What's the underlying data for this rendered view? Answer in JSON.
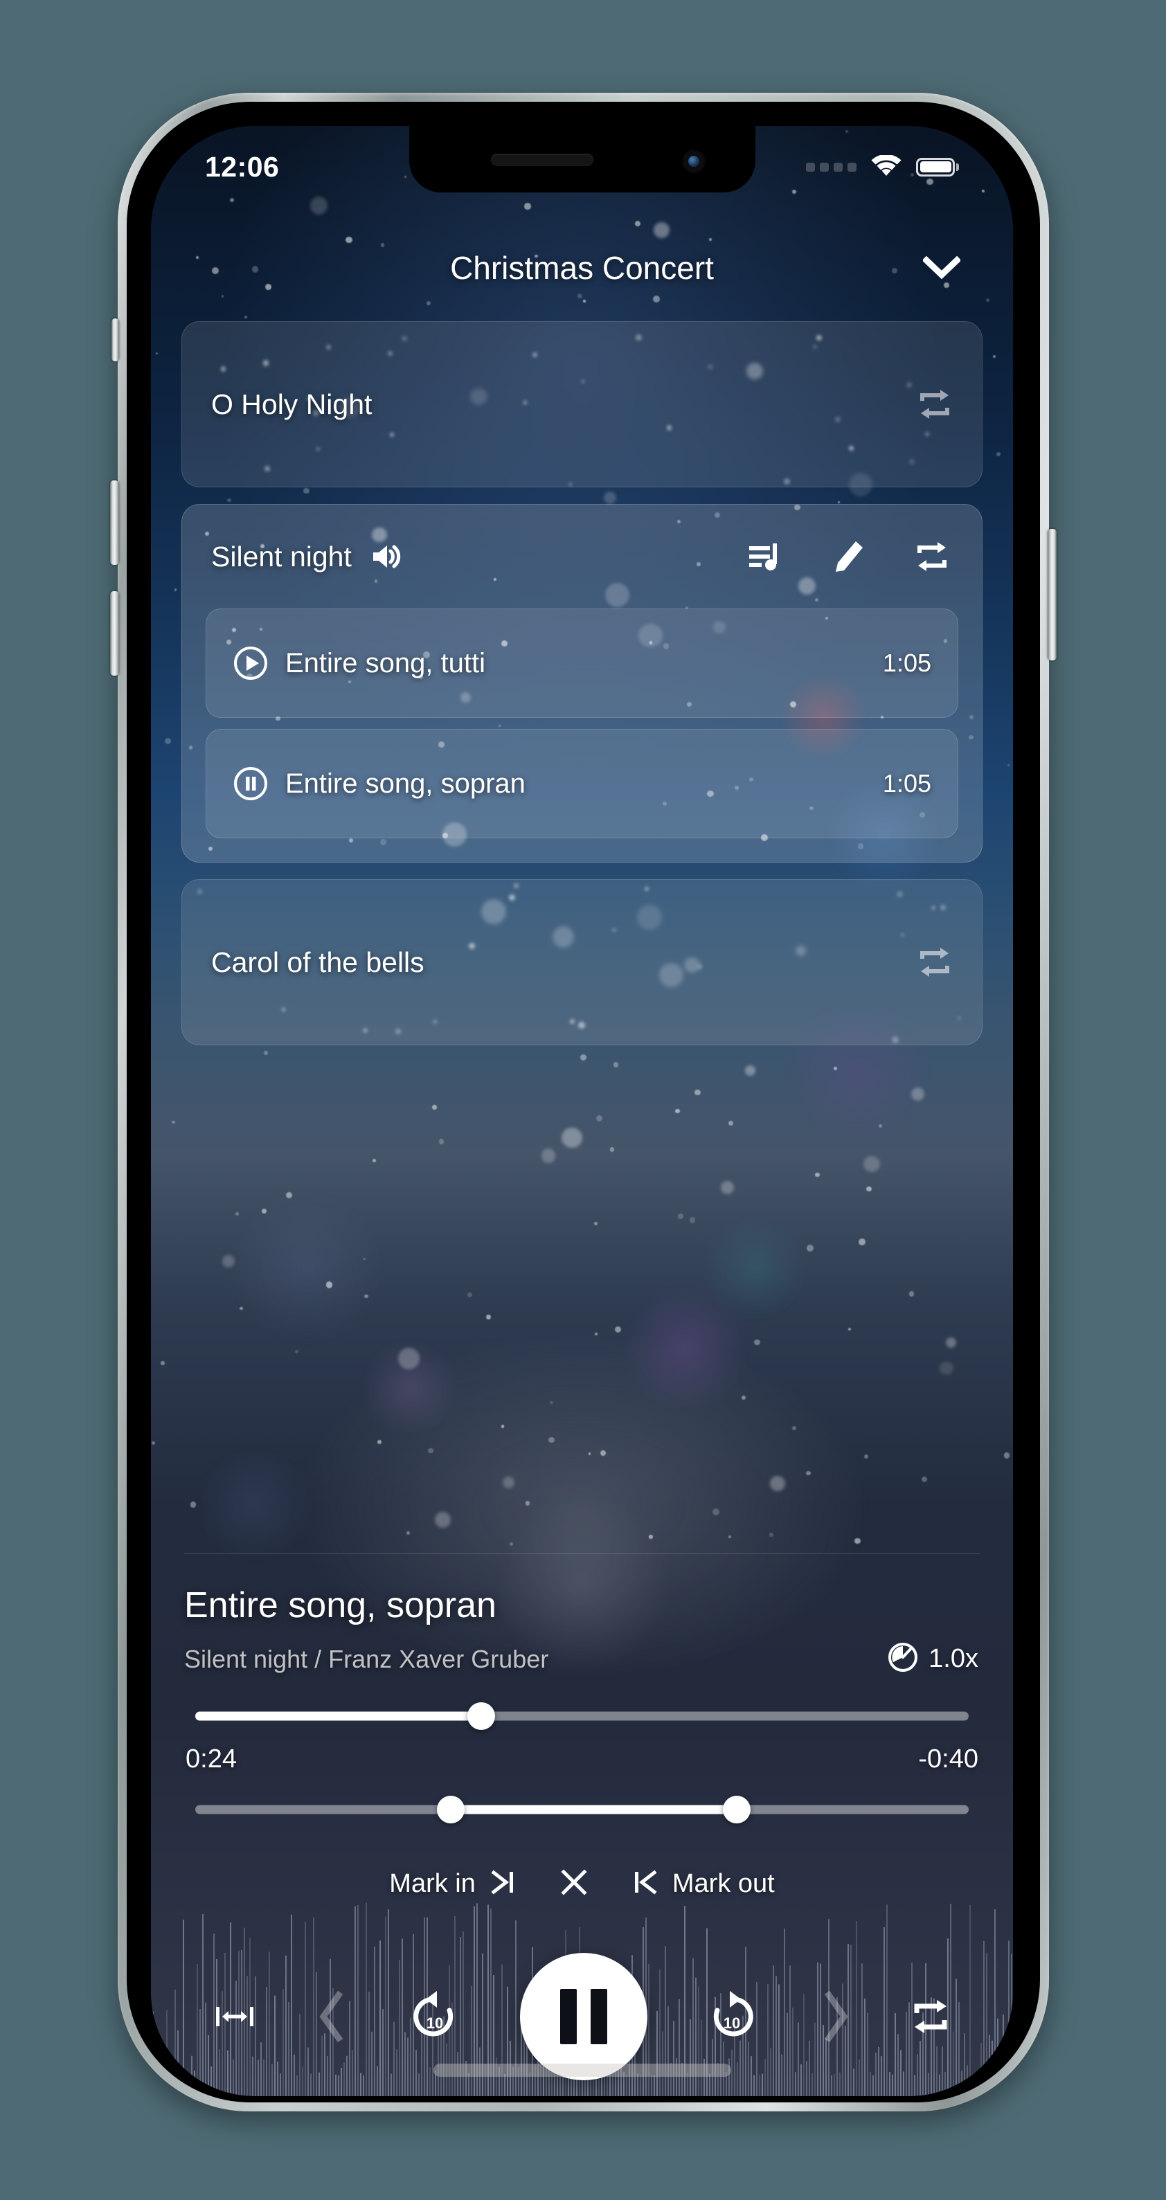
{
  "status_bar": {
    "time": "12:06",
    "cellular_icon": "cellular-dots-icon",
    "wifi_icon": "wifi-icon",
    "battery_icon": "battery-full-icon"
  },
  "header": {
    "title": "Christmas Concert",
    "collapse_icon": "chevron-down-icon"
  },
  "songs": [
    {
      "title": "O Holy Night",
      "repeat_icon": "repeat-icon"
    },
    {
      "title": "Carol of the bells",
      "repeat_icon": "repeat-icon"
    }
  ],
  "expanded_song": {
    "title": "Silent night",
    "volume_icon": "speaker-volume-icon",
    "actions": [
      {
        "name": "queue-music-icon",
        "label": "Queue"
      },
      {
        "name": "pencil-edit-icon",
        "label": "Edit"
      },
      {
        "name": "repeat-icon",
        "label": "Repeat"
      }
    ],
    "takes": [
      {
        "label": "Entire song, tutti",
        "duration": "1:05",
        "state_icon": "play-circle-icon"
      },
      {
        "label": "Entire song, sopran",
        "duration": "1:05",
        "state_icon": "pause-circle-icon"
      }
    ]
  },
  "now_playing": {
    "title": "Entire song, sopran",
    "subtitle": "Silent night / Franz Xaver Gruber",
    "speed_icon": "speedometer-icon",
    "speed_value": "1.0x",
    "elapsed": "0:24",
    "remaining": "-0:40",
    "progress_percent": 37,
    "range_start_percent": 33,
    "range_end_percent": 70
  },
  "marks": {
    "mark_in_label": "Mark in",
    "mark_in_icon": "mark-in-icon",
    "clear_icon": "clear-marks-icon",
    "mark_out_icon": "mark-out-icon",
    "mark_out_label": "Mark out"
  },
  "transport": {
    "loop_region_icon": "loop-region-icon",
    "previous_icon": "chevron-left-icon",
    "rewind_icon": "rewind-10-icon",
    "rewind_seconds": "10",
    "play_pause_icon": "pause-icon",
    "forward_icon": "forward-10-icon",
    "forward_seconds": "10",
    "next_icon": "chevron-right-icon",
    "repeat_icon": "repeat-icon"
  },
  "colors": {
    "accent_white": "#ffffff",
    "background_top": "#091424",
    "background_mid": "#1d4571",
    "background_bottom": "#323849",
    "frame_silver": "#cfd4d4"
  }
}
